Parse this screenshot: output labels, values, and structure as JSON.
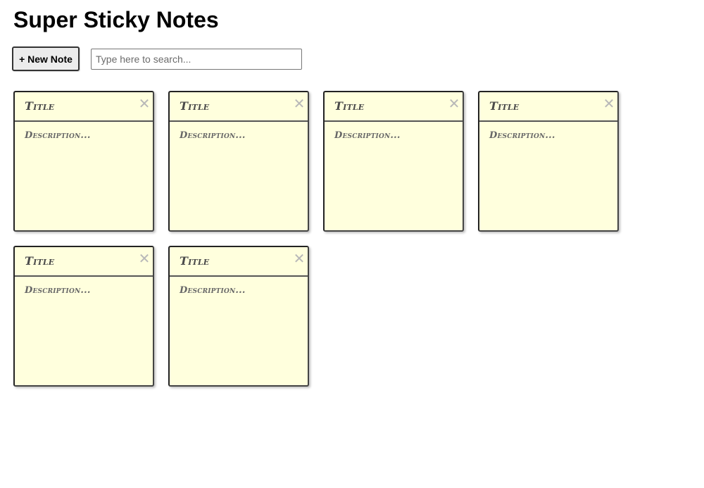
{
  "app": {
    "title": "Super Sticky Notes"
  },
  "toolbar": {
    "new_note_label": "+ New Note",
    "search_placeholder": "Type here to search...",
    "search_value": ""
  },
  "notes": [
    {
      "title": "Title",
      "description": "Description...",
      "close_label": "✕"
    },
    {
      "title": "Title",
      "description": "Description...",
      "close_label": "✕"
    },
    {
      "title": "Title",
      "description": "Description...",
      "close_label": "✕"
    },
    {
      "title": "Title",
      "description": "Description...",
      "close_label": "✕"
    },
    {
      "title": "Title",
      "description": "Description...",
      "close_label": "✕"
    },
    {
      "title": "Title",
      "description": "Description...",
      "close_label": "✕"
    }
  ],
  "colors": {
    "note_background": "#ffffdd",
    "close_icon": "#b8b8b8"
  }
}
